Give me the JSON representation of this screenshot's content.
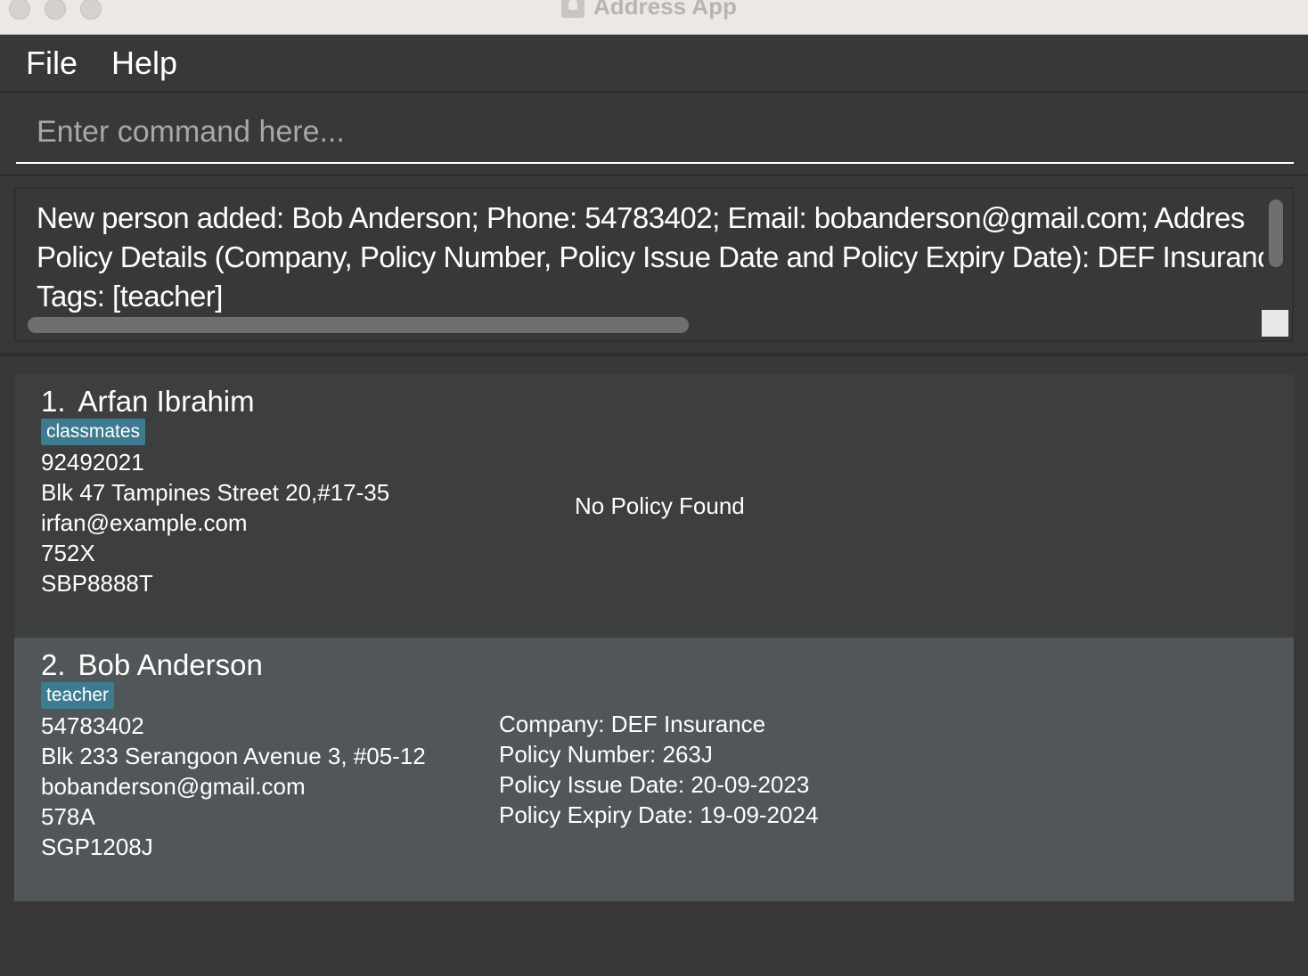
{
  "window": {
    "title": "Address App"
  },
  "menu": {
    "file": "File",
    "help": "Help"
  },
  "command": {
    "placeholder": "Enter command here..."
  },
  "result": {
    "lines": [
      "New person added: Bob Anderson; Phone: 54783402; Email: bobanderson@gmail.com; Addres",
      "Policy Details (Company, Policy Number, Policy Issue Date and Policy Expiry Date): DEF Insuranc",
      "Tags: [teacher]"
    ]
  },
  "persons": [
    {
      "index": "1.",
      "name": "Arfan Ibrahim",
      "tag": "classmates",
      "phone": "92492021",
      "address": "Blk 47 Tampines Street 20,#17-35",
      "email": "irfan@example.com",
      "field4": "752X",
      "field5": "SBP8888T",
      "no_policy": "No Policy Found"
    },
    {
      "index": "2.",
      "name": "Bob Anderson",
      "tag": "teacher",
      "phone": "54783402",
      "address": "Blk 233 Serangoon Avenue 3, #05-12",
      "email": "bobanderson@gmail.com",
      "field4": "578A",
      "field5": "SGP1208J",
      "policy": {
        "company": "Company: DEF Insurance",
        "number": "Policy Number: 263J",
        "issue": "Policy Issue Date: 20-09-2023",
        "expiry": "Policy Expiry Date: 19-09-2024"
      }
    }
  ],
  "colors": {
    "tag": "#3e7b91",
    "selected_card": "#515658",
    "card": "#3c3e3f"
  }
}
